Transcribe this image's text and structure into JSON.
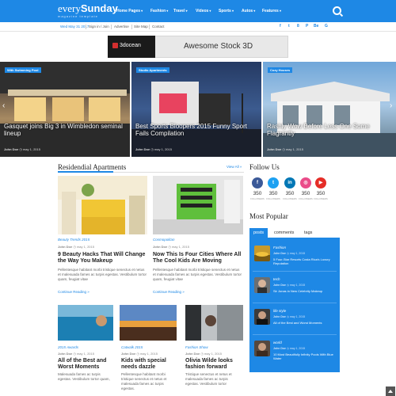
{
  "header": {
    "logo_light": "every",
    "logo_bold": "Sunday",
    "tagline": "magazine template",
    "nav": [
      "Home Pages",
      "Fashion",
      "Travel",
      "Videos",
      "Sports",
      "Autos",
      "Features"
    ]
  },
  "subbar": {
    "date": "Wed May 31 2017",
    "links": [
      "Sign in / Join",
      "Advertise",
      "Site Map",
      "Contact"
    ],
    "social": [
      "f",
      "t",
      "8",
      "P",
      "Be",
      "G"
    ]
  },
  "banner": {
    "brand": "3docean",
    "text": "Awesome Stock 3D"
  },
  "slider": [
    {
      "tag": "With Swimming Pool",
      "title": "Gasquet joins Big 3 in Wimbledon seminal lineup",
      "author": "John Doe",
      "date": "may 1, 2015"
    },
    {
      "tag": "Studio Apartments",
      "title": "Best Sports Bloopers 2015 Funny Sport Fails Compilation",
      "author": "John Doe",
      "date": "may 1, 2015"
    },
    {
      "tag": "Cozy Houses",
      "title": "Rashly Wow Before Less One Some Flagrantly",
      "author": "John Doe",
      "date": "may 1, 2015"
    }
  ],
  "section": {
    "title": "Residendial Apartments",
    "view_all": "View All »"
  },
  "posts_large": [
    {
      "category": "Beauty Trends 2015",
      "author": "John Doe",
      "date": "may 1, 2015",
      "title": "9 Beauty Hacks That Will Change the Way You Makeup",
      "excerpt": "Pellentesque habitant morbi tristique senectus et netus et malesuada fames ac turpis egestas. Vestibulum tortor quam, feugiat vitae",
      "more": "Continue Reading »"
    },
    {
      "category": "Cosmopolitan",
      "author": "John Doe",
      "date": "may 1, 2015",
      "title": "Now This Is Four Cities Where All The Cool Kids Are Moving",
      "excerpt": "Pellentesque habitant morbi tristique senectus et netus et malesuada fames ac turpis egestas. Vestibulum tortor quam, feugiat vitae",
      "more": "Continue Reading »"
    }
  ],
  "posts_small": [
    {
      "category": "2015 Awards",
      "author": "John Doe",
      "date": "may 1, 2015",
      "title": "All of the Best and Worst Moments",
      "excerpt": "Malesuada fames ac turpis egestas. Vestibulum tortor quam,"
    },
    {
      "category": "Catwalk 2015",
      "author": "John Doe",
      "date": "may 1, 2015",
      "title": "Kids with special needs dazzle",
      "excerpt": "Pellentesque habitant morbi tristique senectus et netus et malesuada fames ac turpis egestas."
    },
    {
      "category": "Fashion Show",
      "author": "John Doe",
      "date": "may 1, 2015",
      "title": "Olivia Wilde looks fashion forward",
      "excerpt": "Tristique senectus et netus et malesuada fames ac turpis egestas. Vestibulum tortor"
    }
  ],
  "follow": {
    "title": "Follow Us",
    "items": [
      {
        "icon": "f",
        "count": "350",
        "label": "FOLLOWERS",
        "color": "#3b5998"
      },
      {
        "icon": "t",
        "count": "350",
        "label": "FOLLOWERS",
        "color": "#1da1f2"
      },
      {
        "icon": "in",
        "count": "350",
        "label": "FOLLOWERS",
        "color": "#0077b5"
      },
      {
        "icon": "◎",
        "count": "350",
        "label": "FOLLOWERS",
        "color": "#ea4c89"
      },
      {
        "icon": "▶",
        "count": "350",
        "label": "FOLLOWERS",
        "color": "#e52d27"
      }
    ]
  },
  "popular": {
    "title": "Most Popular",
    "tabs": [
      "posts",
      "comments",
      "tags"
    ],
    "items": [
      {
        "category": "Fashion",
        "author": "John Doe",
        "date": "may 1, 2015",
        "title": "5 Four-Star Resorts Costa Rica's Luxury Reputation"
      },
      {
        "category": "tech",
        "author": "John Doe",
        "date": "may 1, 2015",
        "title": "Sir Jonas in New Celebrity Makeup"
      },
      {
        "category": "life style",
        "author": "John Doe",
        "date": "may 1, 2015",
        "title": "All of the Best and Worst Moments"
      },
      {
        "category": "world",
        "author": "John Doe",
        "date": "may 1, 2015",
        "title": "10 Most Beautifully Infinity Pools With Blue Water"
      }
    ]
  }
}
